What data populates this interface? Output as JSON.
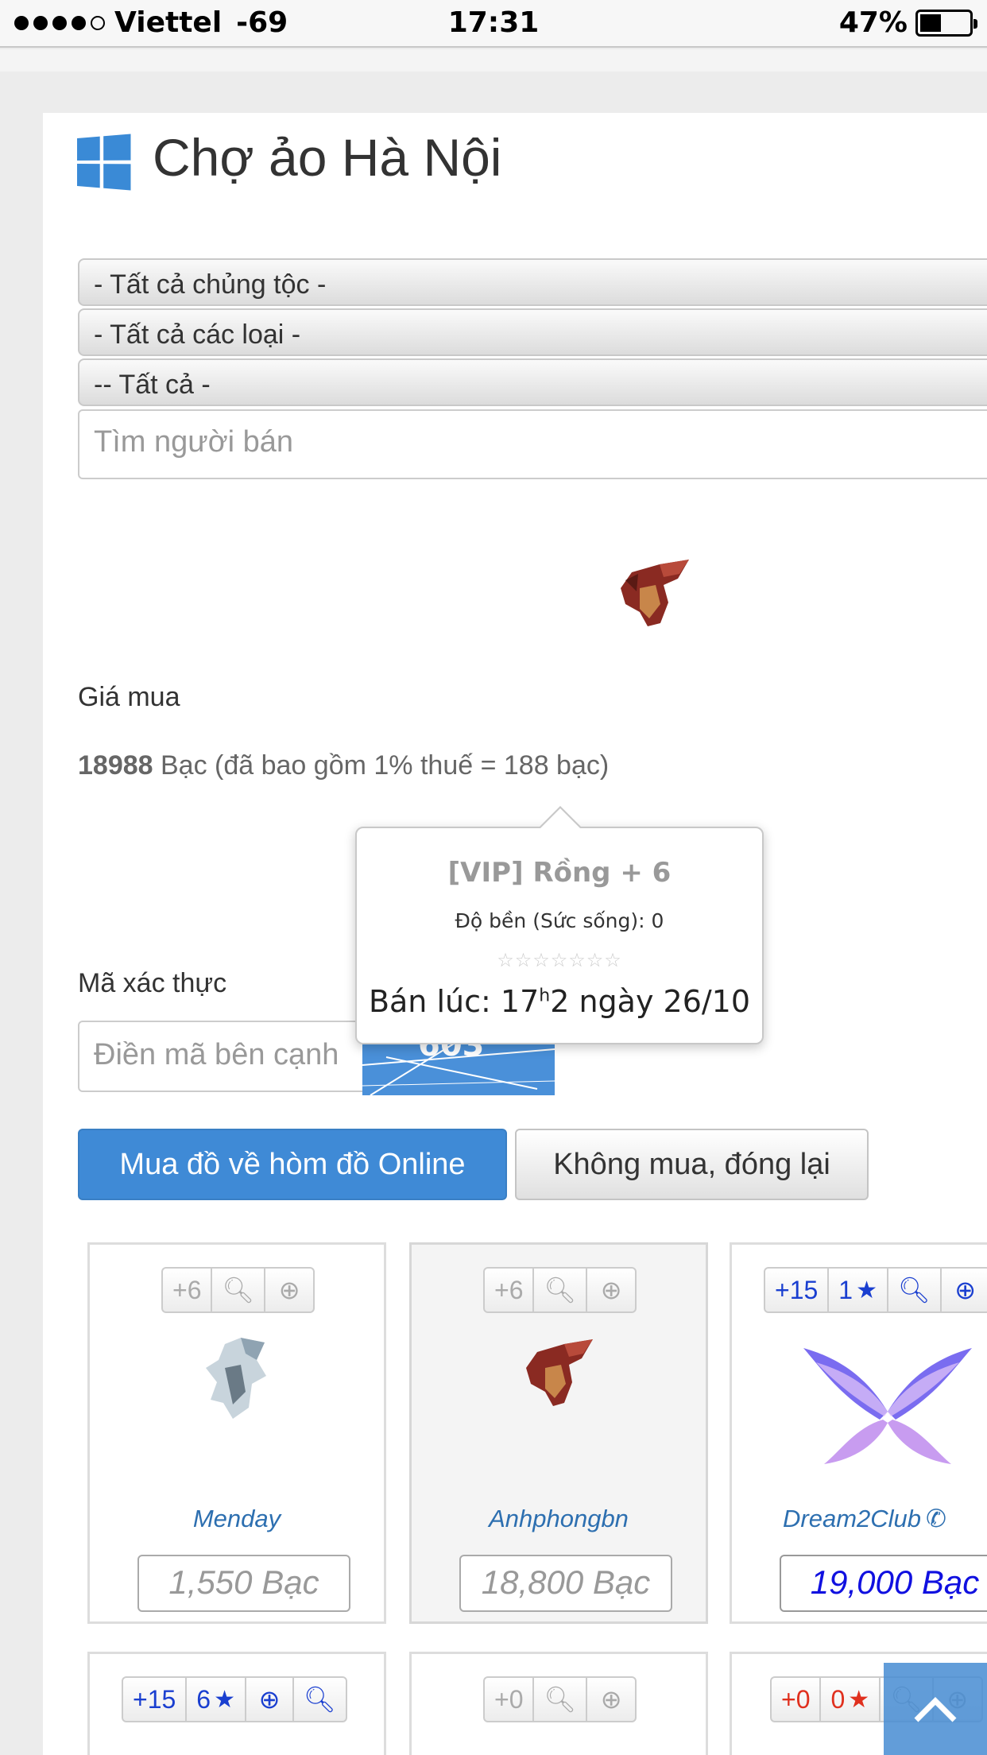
{
  "status_bar": {
    "carrier": "Viettel",
    "signal_db": "-69",
    "time": "17:31",
    "battery": "47%"
  },
  "page": {
    "title": "Chợ ảo Hà Nội"
  },
  "filters": {
    "race": "- Tất cả chủng tộc -",
    "type": "- Tất cả các loại -",
    "all": "-- Tất cả -",
    "seller_placeholder": "Tìm người bán"
  },
  "purchase": {
    "price_label": "Giá mua",
    "price_value": "18988",
    "price_detail": " Bạc (đã bao gồm 1% thuế = 188 bạc)",
    "captcha_label": "Mã xác thực",
    "captcha_placeholder": "Điền mã bên cạnh",
    "captcha_code": "603",
    "buy_button": "Mua đồ về hòm đồ Online",
    "cancel_button": "Không mua, đóng lại"
  },
  "tooltip": {
    "title": "[VIP] Rồng + 6",
    "durability": "Độ bền (Sức sống): 0",
    "stars": "☆☆☆☆☆☆☆",
    "sold_prefix": "Bán lúc: 17",
    "sold_sup": "h",
    "sold_suffix": "2 ngày 26/10"
  },
  "items": [
    {
      "plus": "+6",
      "stars": "",
      "seller": "Menday",
      "price": "1,550 Bạc",
      "phone": false
    },
    {
      "plus": "+6",
      "stars": "",
      "seller": "Anhphongbn",
      "price": "18,800 Bạc",
      "phone": false
    },
    {
      "plus": "+15",
      "stars": "1",
      "seller": "Dream2Club",
      "price": "19,000 Bạc",
      "phone": true
    },
    {
      "plus": "+15",
      "stars": "6"
    },
    {
      "plus": "+0",
      "stars": ""
    },
    {
      "plus": "+0",
      "stars": "0"
    }
  ],
  "colors": {
    "accent": "#3f8ad6",
    "link": "#2d6fb0",
    "price_highlight": "#1010e0",
    "red": "#e0301e"
  }
}
